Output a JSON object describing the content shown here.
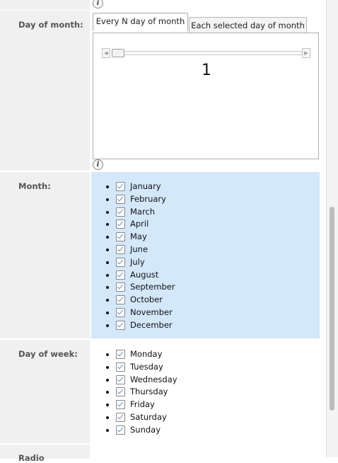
{
  "day_of_month": {
    "label": "Day of month:",
    "tabs": [
      {
        "label": "Every N day of month",
        "active": true
      },
      {
        "label": "Each selected day of month",
        "active": false
      }
    ],
    "slider_value": "1",
    "slider_fraction": 0
  },
  "month": {
    "label": "Month:",
    "items": [
      {
        "label": "January",
        "checked": true
      },
      {
        "label": "February",
        "checked": true
      },
      {
        "label": "March",
        "checked": true
      },
      {
        "label": "April",
        "checked": true
      },
      {
        "label": "May",
        "checked": true
      },
      {
        "label": "June",
        "checked": true
      },
      {
        "label": "July",
        "checked": true
      },
      {
        "label": "August",
        "checked": true
      },
      {
        "label": "September",
        "checked": true
      },
      {
        "label": "October",
        "checked": true
      },
      {
        "label": "November",
        "checked": true
      },
      {
        "label": "December",
        "checked": true
      }
    ]
  },
  "day_of_week": {
    "label": "Day of week:",
    "items": [
      {
        "label": "Monday",
        "checked": true
      },
      {
        "label": "Tuesday",
        "checked": true
      },
      {
        "label": "Wednesday",
        "checked": true
      },
      {
        "label": "Thursday",
        "checked": true
      },
      {
        "label": "Friday",
        "checked": true
      },
      {
        "label": "Saturday",
        "checked": true
      },
      {
        "label": "Sunday",
        "checked": true
      }
    ]
  },
  "next_row_label_partial": "Radio",
  "info_icon_glyph": "i",
  "colors": {
    "label_bg": "#f0f0f0",
    "selected_row_bg": "#d4e8fb",
    "label_text": "#555555"
  }
}
